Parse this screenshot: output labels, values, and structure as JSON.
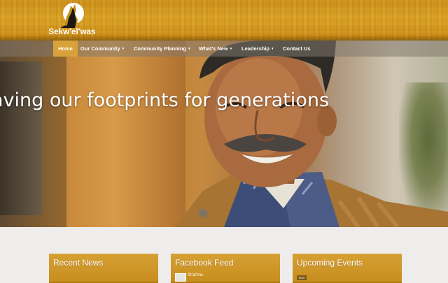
{
  "site": {
    "name": "Sekw'el'was"
  },
  "nav": {
    "items": [
      {
        "label": "Home",
        "active": true,
        "dropdown": false
      },
      {
        "label": "Our Community",
        "dropdown": true
      },
      {
        "label": "Community Planning",
        "dropdown": true
      },
      {
        "label": "What's New",
        "dropdown": true
      },
      {
        "label": "Leadership",
        "dropdown": true
      },
      {
        "label": "Contact Us",
        "dropdown": false
      }
    ],
    "caret": "▾"
  },
  "hero": {
    "headline": "aving our footprints for generations"
  },
  "widgets": {
    "recent_news": {
      "title": "Recent News"
    },
    "facebook_feed": {
      "title": "Facebook Feed",
      "first_item": "St'at'imc"
    },
    "upcoming_events": {
      "title": "Upcoming Events",
      "badge": "NOV"
    }
  },
  "colors": {
    "header_gold": "#d99f24",
    "nav_active": "#d9a13a",
    "widget_gold": "#d6a033",
    "page_bg": "#efedeb"
  },
  "icons": {
    "logo": "wolf-moon-logo-icon"
  }
}
